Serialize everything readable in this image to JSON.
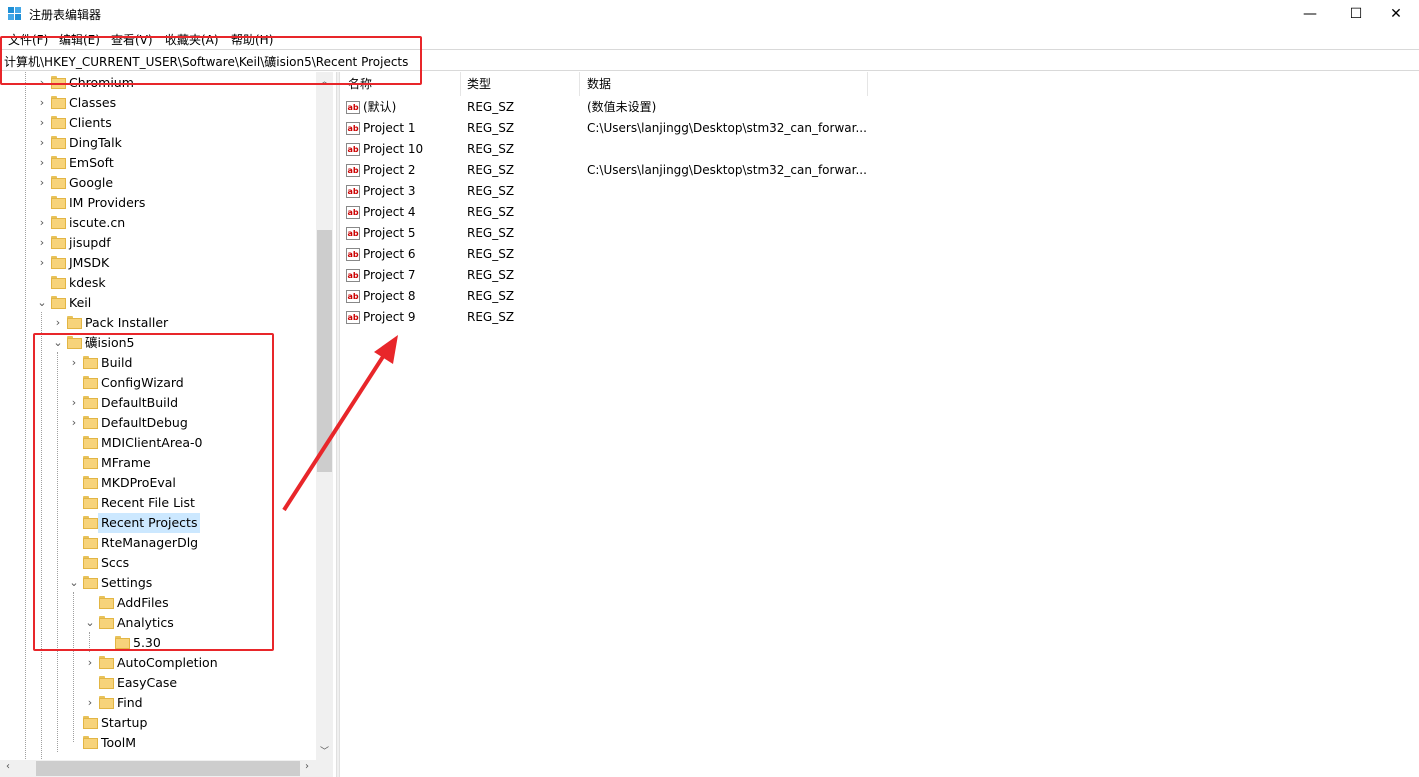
{
  "window": {
    "title": "注册表编辑器",
    "minimize": "—",
    "maximize": "☐",
    "close": "✕"
  },
  "menu": [
    "文件(F)",
    "编辑(E)",
    "查看(V)",
    "收藏夹(A)",
    "帮助(H)"
  ],
  "address": "计算机\\HKEY_CURRENT_USER\\Software\\Keil\\礦ision5\\Recent Projects",
  "tree": [
    {
      "label": "Chromium",
      "expander": "›"
    },
    {
      "label": "Classes",
      "expander": "›"
    },
    {
      "label": "Clients",
      "expander": "›"
    },
    {
      "label": "DingTalk",
      "expander": "›"
    },
    {
      "label": "EmSoft",
      "expander": "›"
    },
    {
      "label": "Google",
      "expander": "›"
    },
    {
      "label": "IM Providers",
      "expander": ""
    },
    {
      "label": "iscute.cn",
      "expander": "›"
    },
    {
      "label": "jisupdf",
      "expander": "›"
    },
    {
      "label": "JMSDK",
      "expander": "›"
    },
    {
      "label": "kdesk",
      "expander": ""
    },
    {
      "label": "Keil",
      "expander": "⌄"
    },
    {
      "label": "Pack Installer",
      "expander": "›"
    },
    {
      "label": "礦ision5",
      "expander": "⌄"
    },
    {
      "label": "Build",
      "expander": "›"
    },
    {
      "label": "ConfigWizard",
      "expander": ""
    },
    {
      "label": "DefaultBuild",
      "expander": "›"
    },
    {
      "label": "DefaultDebug",
      "expander": "›"
    },
    {
      "label": "MDIClientArea-0",
      "expander": ""
    },
    {
      "label": "MFrame",
      "expander": ""
    },
    {
      "label": "MKDProEval",
      "expander": ""
    },
    {
      "label": "Recent File List",
      "expander": ""
    },
    {
      "label": "Recent Projects",
      "expander": "",
      "selected": true
    },
    {
      "label": "RteManagerDlg",
      "expander": ""
    },
    {
      "label": "Sccs",
      "expander": ""
    },
    {
      "label": "Settings",
      "expander": "⌄"
    },
    {
      "label": "AddFiles",
      "expander": ""
    },
    {
      "label": "Analytics",
      "expander": "⌄"
    },
    {
      "label": "5.30",
      "expander": ""
    },
    {
      "label": "AutoCompletion",
      "expander": "›"
    },
    {
      "label": "EasyCase",
      "expander": ""
    },
    {
      "label": "Find",
      "expander": "›"
    },
    {
      "label": "Startup",
      "expander": ""
    },
    {
      "label": "ToolM",
      "expander": ""
    }
  ],
  "list": {
    "columns": [
      "名称",
      "类型",
      "数据"
    ],
    "rows": [
      {
        "name": "(默认)",
        "type": "REG_SZ",
        "data": "(数值未设置)"
      },
      {
        "name": "Project 1",
        "type": "REG_SZ",
        "data": "C:\\Users\\lanjingg\\Desktop\\stm32_can_forwar..."
      },
      {
        "name": "Project 10",
        "type": "REG_SZ",
        "data": ""
      },
      {
        "name": "Project 2",
        "type": "REG_SZ",
        "data": "C:\\Users\\lanjingg\\Desktop\\stm32_can_forwar..."
      },
      {
        "name": "Project 3",
        "type": "REG_SZ",
        "data": ""
      },
      {
        "name": "Project 4",
        "type": "REG_SZ",
        "data": ""
      },
      {
        "name": "Project 5",
        "type": "REG_SZ",
        "data": ""
      },
      {
        "name": "Project 6",
        "type": "REG_SZ",
        "data": ""
      },
      {
        "name": "Project 7",
        "type": "REG_SZ",
        "data": ""
      },
      {
        "name": "Project 8",
        "type": "REG_SZ",
        "data": ""
      },
      {
        "name": "Project 9",
        "type": "REG_SZ",
        "data": ""
      }
    ]
  },
  "icons": {
    "value_icon": "ab",
    "folder": "folder-icon"
  },
  "colors": {
    "annotation": "#e8262a",
    "selection": "#cce8ff"
  }
}
